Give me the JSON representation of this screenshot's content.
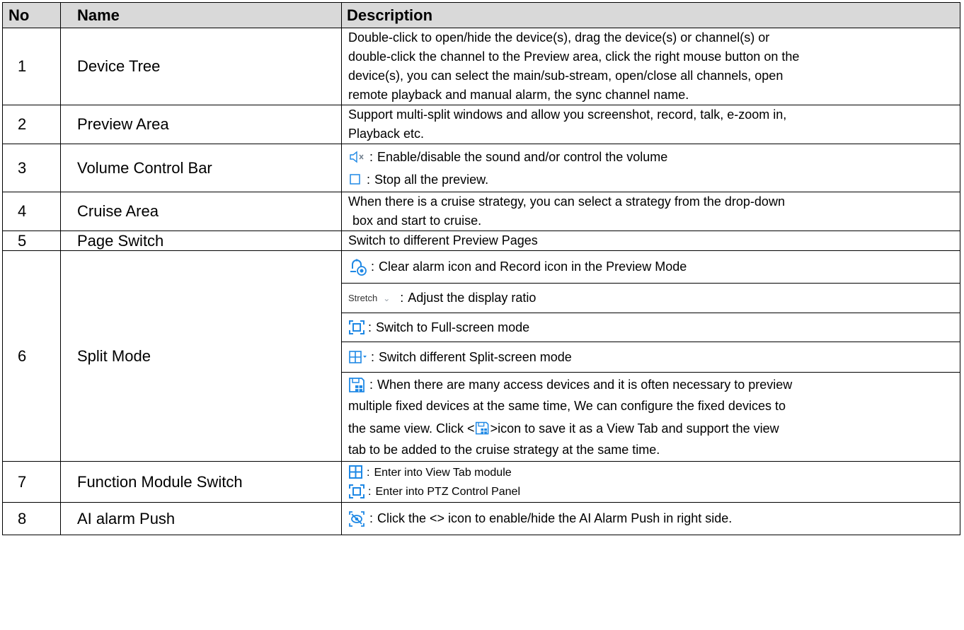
{
  "headers": {
    "no": "No",
    "name": "Name",
    "description": "Description"
  },
  "rows": [
    {
      "no": "1",
      "name": "Device Tree",
      "lines": [
        "Double-click to open/hide the device(s), drag the device(s) or channel(s) or",
        "double-click the channel to the Preview area, click the right mouse button on the",
        "device(s), you can select the main/sub-stream, open/close all channels, open",
        "remote playback and manual alarm, the sync channel name."
      ]
    },
    {
      "no": "2",
      "name": "Preview Area",
      "lines": [
        "Support multi-split windows and allow you screenshot, record, talk, e-zoom in,",
        "Playback etc."
      ]
    },
    {
      "no": "3",
      "name": "Volume Control Bar",
      "items": [
        {
          "icon": "speaker-mute-icon",
          "text": "Enable/disable the sound and/or control the volume"
        },
        {
          "icon": "stop-icon",
          "text": "Stop all the preview."
        }
      ]
    },
    {
      "no": "4",
      "name": "Cruise Area",
      "lines": [
        "When there is a cruise strategy, you can select a strategy from the drop-down",
        "box and start to cruise."
      ]
    },
    {
      "no": "5",
      "name": "Page Switch",
      "text": "Switch to different Preview Pages"
    },
    {
      "no": "6",
      "name": "Split Mode",
      "items": [
        {
          "icon": "clear-alarm-icon",
          "text": "Clear alarm icon and Record icon in the Preview Mode"
        },
        {
          "icon": "stretch-dropdown",
          "dropdown": "Stretch",
          "text": "Adjust the display ratio"
        },
        {
          "icon": "fullscreen-icon",
          "text": "Switch to Full-screen mode"
        },
        {
          "icon": "split-screen-icon",
          "text": "Switch different Split-screen mode"
        },
        {
          "icon": "save-view-icon",
          "text": "When there are many access devices and it is often necessary to preview",
          "lines": [
            "multiple fixed devices at the same time, We can configure the fixed devices to",
            "the same view. Click <",
            ">icon to save it as a View Tab and support the view",
            "tab to be added to the cruise strategy at the same time."
          ]
        }
      ]
    },
    {
      "no": "7",
      "name": "Function Module Switch",
      "items": [
        {
          "icon": "view-tab-icon",
          "text": "Enter into View Tab module"
        },
        {
          "icon": "ptz-icon",
          "text": "Enter into PTZ Control Panel"
        }
      ]
    },
    {
      "no": "8",
      "name": "AI alarm Push",
      "items": [
        {
          "icon": "ai-alarm-icon",
          "text": "Click the <> icon to enable/hide the AI Alarm Push in right side."
        }
      ]
    }
  ],
  "separator": ":",
  "colors": {
    "header_bg": "#d9d9d9",
    "icon_blue": "#1e88e5",
    "icon_grey": "#6d7b8a"
  }
}
